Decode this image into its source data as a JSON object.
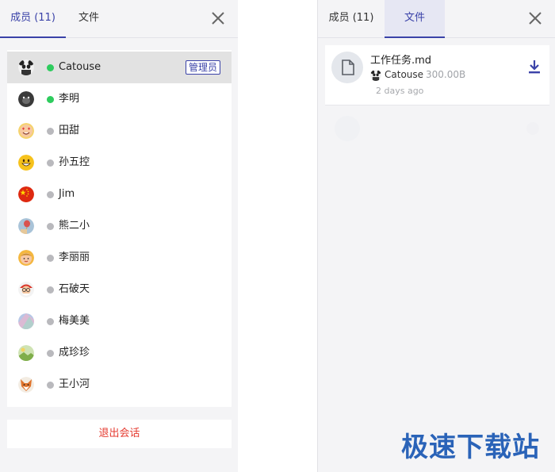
{
  "left_panel": {
    "tabs": [
      {
        "label": "成员 (11)",
        "active": true
      },
      {
        "label": "文件",
        "active": false
      }
    ],
    "close_icon": "close-icon",
    "members": [
      {
        "name": "Catouse",
        "online": true,
        "admin": true,
        "badge": "管理员",
        "avatar": "panda-avatar"
      },
      {
        "name": "李明",
        "online": true,
        "admin": false,
        "avatar": "gorilla-avatar"
      },
      {
        "name": "田甜",
        "online": false,
        "admin": false,
        "avatar": "heart-eyes-emoji-avatar"
      },
      {
        "name": "孙五控",
        "online": false,
        "admin": false,
        "avatar": "grin-emoji-avatar"
      },
      {
        "name": "Jim",
        "online": false,
        "admin": false,
        "avatar": "china-flag-avatar"
      },
      {
        "name": "熊二小",
        "online": false,
        "admin": false,
        "avatar": "balloon-avatar"
      },
      {
        "name": "李丽丽",
        "online": false,
        "admin": false,
        "avatar": "face-avatar"
      },
      {
        "name": "石破天",
        "online": false,
        "admin": false,
        "avatar": "santa-avatar"
      },
      {
        "name": "梅美美",
        "online": false,
        "admin": false,
        "avatar": "pastel-avatar"
      },
      {
        "name": "成珍珍",
        "online": false,
        "admin": false,
        "avatar": "landscape-avatar"
      },
      {
        "name": "王小河",
        "online": false,
        "admin": false,
        "avatar": "fox-avatar"
      }
    ],
    "leave_button": "退出会话"
  },
  "right_panel": {
    "tabs": [
      {
        "label": "成员 (11)",
        "active": false
      },
      {
        "label": "文件",
        "active": true
      }
    ],
    "close_icon": "close-icon",
    "files": [
      {
        "name": "工作任务.md",
        "uploader": "Catouse",
        "size": "300.00B",
        "time": "2 days ago",
        "icon": "document-icon",
        "action_icon": "download-icon"
      }
    ]
  },
  "watermark": "极速下载站",
  "colors": {
    "accent": "#3a42a8",
    "online": "#2ecc5e",
    "offline": "#b9b9bd",
    "danger": "#e53b30",
    "watermark": "#2a63b8"
  }
}
